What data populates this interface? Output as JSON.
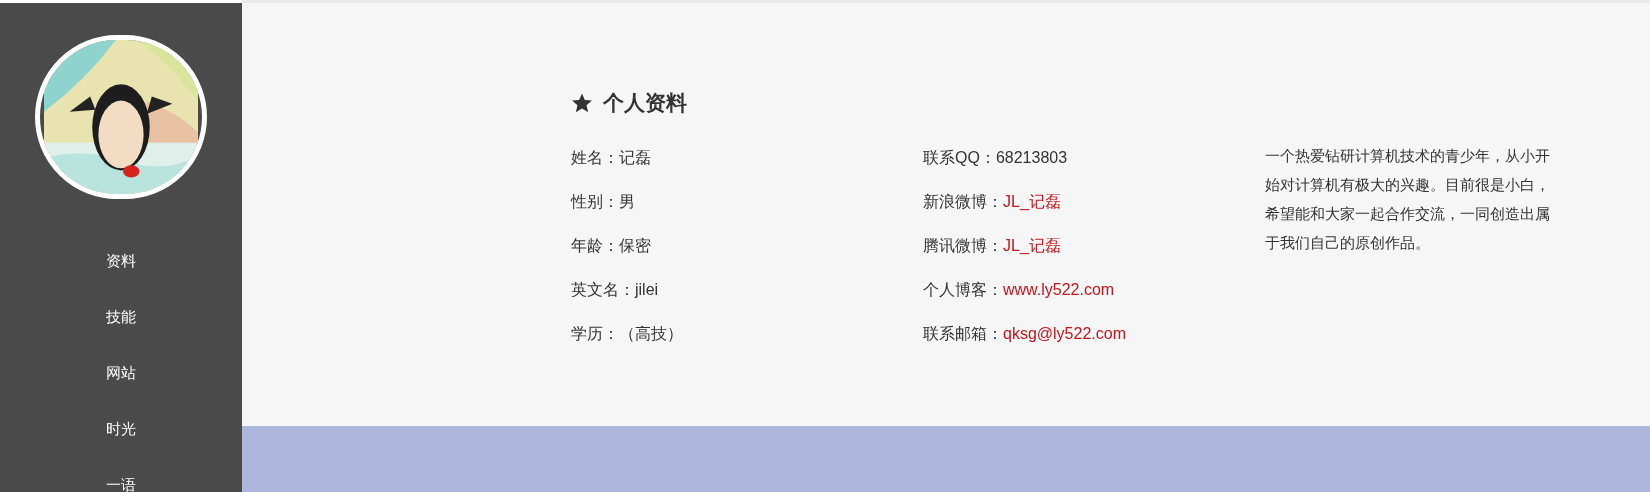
{
  "sidebar": {
    "nav": [
      {
        "label": "资料"
      },
      {
        "label": "技能"
      },
      {
        "label": "网站"
      },
      {
        "label": "时光"
      },
      {
        "label": "一语"
      }
    ]
  },
  "profile": {
    "title": "个人资料",
    "column_1": [
      {
        "label": "姓名：",
        "value": "记磊",
        "kind": "text"
      },
      {
        "label": "性别：",
        "value": "男",
        "kind": "text"
      },
      {
        "label": "年龄：",
        "value": "保密",
        "kind": "text"
      },
      {
        "label": "英文名：",
        "value": "jilei",
        "kind": "text"
      },
      {
        "label": "学历：",
        "value": "（高技）",
        "kind": "text"
      }
    ],
    "column_2": [
      {
        "label": "联系QQ：",
        "value": "68213803",
        "kind": "text"
      },
      {
        "label": "新浪微博：",
        "value": "JL_记磊",
        "kind": "link"
      },
      {
        "label": "腾讯微博：",
        "value": "JL_记磊",
        "kind": "link"
      },
      {
        "label": "个人博客：",
        "value": "www.ly522.com",
        "kind": "link"
      },
      {
        "label": "联系邮箱：",
        "value": "qksg@ly522.com",
        "kind": "link"
      }
    ],
    "bio": "一个热爱钻研计算机技术的青少年，从小开始对计算机有极大的兴趣。目前很是小白，希望能和大家一起合作交流，一同创造出属于我们自己的原创作品。"
  }
}
